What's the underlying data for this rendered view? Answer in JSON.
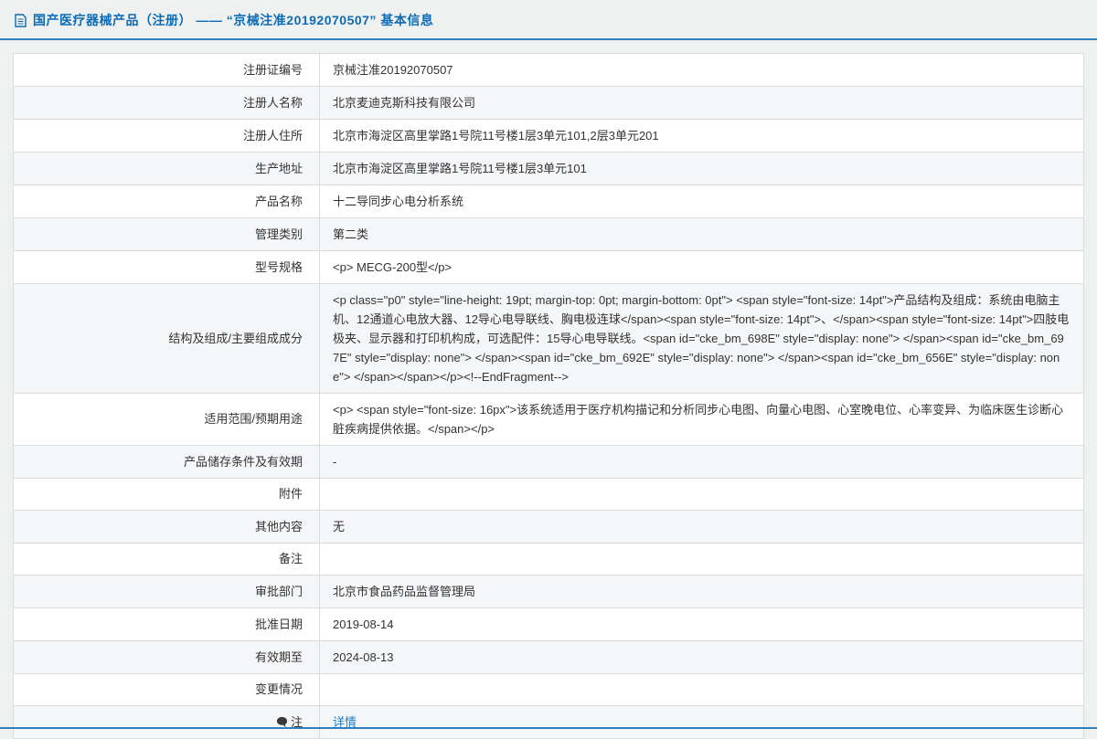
{
  "colors": {
    "accent_blue": "#0d6cb5",
    "border_blue": "#2e80c0",
    "table_border": "#dcdcdc",
    "stripe_bg": "#f5f6f8",
    "link": "#1b7fd0",
    "page_bg": "#eff0f0"
  },
  "header": {
    "icon": "document-icon",
    "title": "国产医疗器械产品（注册） —— “京械注准20192070507” 基本信息"
  },
  "table": {
    "rows": [
      {
        "label": "注册证编号",
        "value": "京械注准20192070507"
      },
      {
        "label": "注册人名称",
        "value": "北京麦迪克斯科技有限公司"
      },
      {
        "label": "注册人住所",
        "value": "北京市海淀区高里掌路1号院11号楼1层3单元101,2层3单元201"
      },
      {
        "label": "生产地址",
        "value": "北京市海淀区高里掌路1号院11号楼1层3单元101"
      },
      {
        "label": "产品名称",
        "value": "十二导同步心电分析系统"
      },
      {
        "label": "管理类别",
        "value": "第二类"
      },
      {
        "label": "型号规格",
        "value": "<p> MECG-200型</p>"
      },
      {
        "label": "结构及组成/主要组成成分",
        "value": "<p class=\"p0\" style=\"line-height: 19pt; margin-top: 0pt; margin-bottom: 0pt\"> <span style=\"font-size: 14pt\">产品结构及组成：系统由电脑主机、12通道心电放大器、12导心电导联线、胸电极连球</span><span style=\"font-size: 14pt\">、</span><span style=\"font-size: 14pt\">四肢电极夹、显示器和打印机构成，可选配件：15导心电导联线。<span id=\"cke_bm_698E\" style=\"display: none\"> </span><span id=\"cke_bm_697E\" style=\"display: none\"> </span><span id=\"cke_bm_692E\" style=\"display: none\"> </span><span id=\"cke_bm_656E\" style=\"display: none\"> </span></span></p><!--EndFragment-->"
      },
      {
        "label": "适用范围/预期用途",
        "value": "<p> <span style=\"font-size: 16px\">该系统适用于医疗机构描记和分析同步心电图、向量心电图、心室晚电位、心率变异、为临床医生诊断心脏疾病提供依据。</span></p>"
      },
      {
        "label": "产品储存条件及有效期",
        "value": "-"
      },
      {
        "label": "附件",
        "value": ""
      },
      {
        "label": "其他内容",
        "value": "无"
      },
      {
        "label": "备注",
        "value": ""
      },
      {
        "label": "审批部门",
        "value": "北京市食品药品监督管理局"
      },
      {
        "label": "批准日期",
        "value": "2019-08-14"
      },
      {
        "label": "有效期至",
        "value": "2024-08-13"
      },
      {
        "label": "变更情况",
        "value": ""
      },
      {
        "label": "注",
        "value": "详情"
      }
    ]
  }
}
